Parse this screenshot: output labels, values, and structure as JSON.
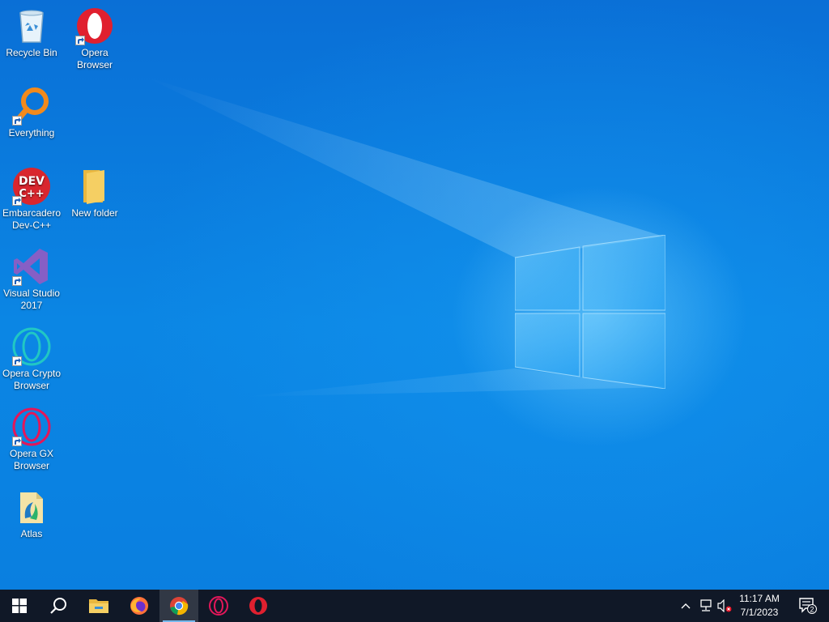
{
  "desktop": {
    "icons": [
      {
        "label": "Recycle Bin",
        "icon": "recycle-bin-icon"
      },
      {
        "label": "Opera Browser",
        "icon": "opera-icon"
      },
      {
        "label": "Everything",
        "icon": "everything-search-icon"
      },
      {
        "label": "Embarcadero Dev-C++",
        "icon": "devcpp-icon"
      },
      {
        "label": "New folder",
        "icon": "folder-icon"
      },
      {
        "label": "Visual Studio 2017",
        "icon": "visual-studio-icon"
      },
      {
        "label": "Opera Crypto Browser",
        "icon": "opera-crypto-icon"
      },
      {
        "label": "Opera GX Browser",
        "icon": "opera-gx-icon"
      },
      {
        "label": "Atlas",
        "icon": "atlas-icon"
      }
    ],
    "devcpp_glyph_text": {
      "line1": "DEV",
      "line2": "C++"
    }
  },
  "taskbar": {
    "pinned": [
      {
        "name": "start",
        "icon": "windows-start-icon"
      },
      {
        "name": "search",
        "icon": "search-icon"
      },
      {
        "name": "file-explorer",
        "icon": "file-explorer-icon"
      },
      {
        "name": "firefox",
        "icon": "firefox-icon"
      },
      {
        "name": "chrome",
        "icon": "chrome-icon",
        "active": true
      },
      {
        "name": "opera-gx",
        "icon": "opera-gx-icon"
      },
      {
        "name": "opera",
        "icon": "opera-icon"
      }
    ],
    "tray": {
      "clock_time": "11:17 AM",
      "clock_date": "7/1/2023",
      "notification_count": "2"
    }
  },
  "colors": {
    "taskbar": "#101827",
    "desktop_blue": "#0a7fe0",
    "opera_red": "#e0202f",
    "opera_gx_pink": "#e3175a",
    "opera_crypto_teal": "#21c7c4",
    "vs_purple": "#865fc5",
    "folder_yellow": "#f5cf63"
  }
}
